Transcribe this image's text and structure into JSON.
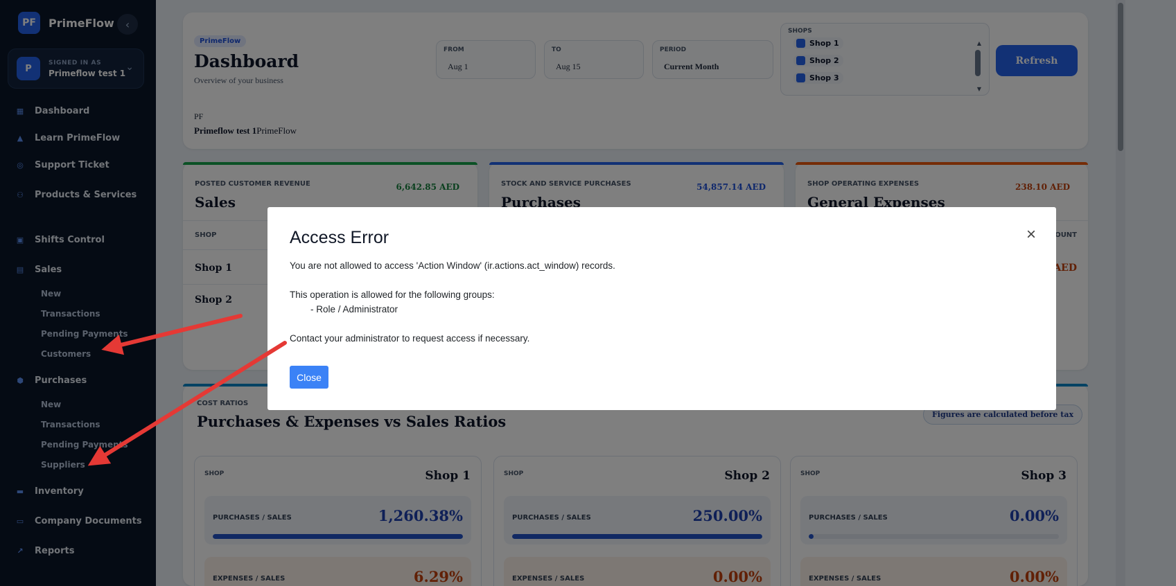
{
  "brand": {
    "logo_text": "PF",
    "name": "PrimeFlow"
  },
  "user": {
    "caption": "SIGNED IN AS",
    "avatar": "P",
    "name": "Primeflow test 1"
  },
  "nav": {
    "dashboard": "Dashboard",
    "learn": "Learn PrimeFlow",
    "support": "Support Ticket",
    "products": "Products & Services",
    "shifts": "Shifts Control",
    "sales": "Sales",
    "sales_new": "New",
    "sales_transactions": "Transactions",
    "sales_pending": "Pending Payments",
    "sales_customers": "Customers",
    "purchases": "Purchases",
    "purchases_new": "New",
    "purchases_transactions": "Transactions",
    "purchases_pending": "Pending Payments",
    "purchases_suppliers": "Suppliers",
    "inventory": "Inventory",
    "documents": "Company Documents",
    "reports": "Reports"
  },
  "header": {
    "pill": "PrimeFlow",
    "title": "Dashboard",
    "subtitle": "Overview of your business",
    "from_label": "FROM",
    "from_value": "Aug 1",
    "to_label": "TO",
    "to_value": "Aug 15",
    "period_label": "PERIOD",
    "period_value": "Current Month",
    "shops_label": "SHOPS",
    "shops": [
      "Shop 1",
      "Shop 2",
      "Shop 3"
    ],
    "refresh": "Refresh",
    "pf_short": "PF",
    "pf_user": "Primeflow test 1",
    "pf_company": "PrimeFlow"
  },
  "kpis": [
    {
      "caption": "POSTED CUSTOMER REVENUE",
      "title": "Sales",
      "amount": "6,642.85 AED",
      "color": "#15803d",
      "top": "#16a34a",
      "col": "SHOP",
      "rows": [
        "Shop 1",
        "Shop 2"
      ]
    },
    {
      "caption": "STOCK AND SERVICE PURCHASES",
      "title": "Purchases",
      "amount": "54,857.14 AED",
      "color": "#1d4ed8",
      "top": "#2563eb"
    },
    {
      "caption": "SHOP OPERATING EXPENSES",
      "title": "General Expenses",
      "amount": "238.10 AED",
      "color": "#c2410c",
      "top": "#ea580c",
      "col": "OUNT",
      "row_amount": "AED"
    }
  ],
  "ratios": {
    "caption": "COST RATIOS",
    "title": "Purchases & Expenses vs Sales Ratios",
    "tax_note": "Figures are calculated before tax",
    "shop_label": "SHOP",
    "purchases_label": "PURCHASES / SALES",
    "expenses_label": "EXPENSES / SALES",
    "cards": [
      {
        "name": "Shop 1",
        "purchases": "1,260.38%",
        "purchases_fill": 1.0,
        "expenses": "6.29%"
      },
      {
        "name": "Shop 2",
        "purchases": "250.00%",
        "purchases_fill": 1.0,
        "expenses": "0.00%"
      },
      {
        "name": "Shop 3",
        "purchases": "0.00%",
        "purchases_fill": 0.0,
        "expenses": "0.00%"
      }
    ],
    "value_color_blue": "#1e40af",
    "value_color_orange": "#c2410c"
  },
  "modal": {
    "title": "Access Error",
    "line1": "You are not allowed to access 'Action Window' (ir.actions.act_window) records.",
    "line2": "This operation is allowed for the following groups:",
    "line3": "        - Role / Administrator",
    "line4": "Contact your administrator to request access if necessary.",
    "close_label": "Close"
  },
  "annotation_color": "#e53935"
}
